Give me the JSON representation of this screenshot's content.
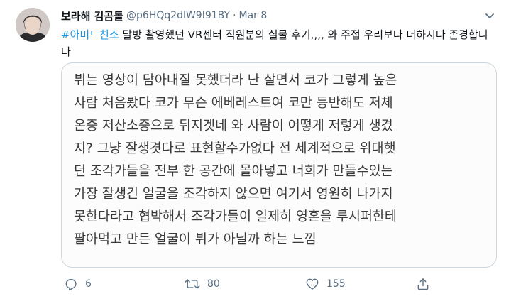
{
  "tweet": {
    "display_name": "보라해 김곰돌",
    "handle": "@p6HQq2dlW9I91BY",
    "separator": "·",
    "date": "Mar 8",
    "hashtag": "#아미트친소",
    "text_rest": " 달방 촬영했던 VR센터 직원분의 실물 후기,,,, 와 주접 우리보다 더하시다 존경합니다",
    "card_lines": [
      "뷔는 영상이 담아내질 못했더라 난 살면서 코가 그렇게 높은",
      "사람 처음봤다 코가 무슨 에베레스트여 코만 등반해도 저체",
      "온증 저산소증으로 뒤지겟네 와 사람이 어떻게 저렇게 생겼",
      "지? 그냥 잘생겻다로 표현할수가없다 전 세계적으로 위대햇",
      "던 조각가들을 전부 한 공간에 몰아넣고 너희가 만들수있는",
      "가장 잘생긴 얼굴을 조각하지 않으면 여기서 영원히 나가지",
      "못한다라고 협박해서 조각가들이 일제히 영혼을 루시퍼한테",
      "팔아먹고 만든 얼굴이 뷔가 아닐까 하는 느낌"
    ],
    "actions": {
      "reply_count": "6",
      "retweet_count": "80",
      "like_count": "155"
    }
  },
  "icons": {
    "reply": "reply-icon",
    "retweet": "retweet-icon",
    "like": "heart-icon",
    "share": "share-icon",
    "more": "chevron-down-icon"
  },
  "colors": {
    "hashtag": "#1b95e0",
    "secondary_text": "#5b7083",
    "border": "#ccd6dd"
  }
}
